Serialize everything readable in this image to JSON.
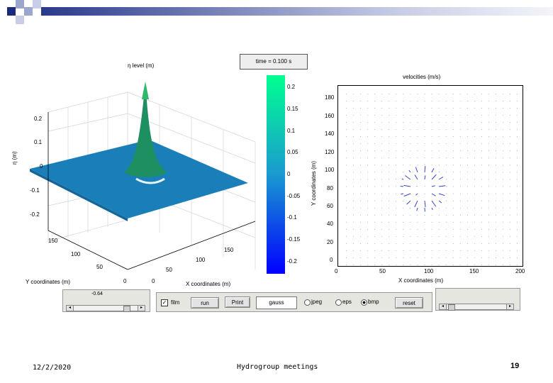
{
  "footer": {
    "date": "12/2/2020",
    "title": "Hydrogroup meetings",
    "page": "19"
  },
  "time_display": "time = 0.100 s",
  "left_plot": {
    "title": "η level (m)",
    "zlabel": "η (m)",
    "xlabel": "X coordinates (m)",
    "ylabel": "Y coordinates (m)",
    "z_ticks": [
      "0.2",
      "0.1",
      "0",
      "-0.1",
      "-0.2"
    ],
    "x_ticks": [
      "0",
      "50",
      "100",
      "150"
    ],
    "y_ticks": [
      "0",
      "50",
      "100",
      "150"
    ]
  },
  "colorbar": {
    "ticks": [
      "0.2",
      "0.15",
      "0.1",
      "0.05",
      "0",
      "-0.05",
      "-0.1",
      "-0.15",
      "-0.2"
    ],
    "min": -0.2,
    "max": 0.2
  },
  "right_plot": {
    "title": "velocities (m/s)",
    "xlabel": "X coordinates (m)",
    "ylabel": "Y coordinates (m)",
    "x_ticks": [
      "0",
      "50",
      "100",
      "150",
      "200"
    ],
    "y_ticks": [
      "0",
      "20",
      "40",
      "60",
      "80",
      "100",
      "120",
      "140",
      "160",
      "180"
    ]
  },
  "controls": {
    "left_slider_value": "-0.64",
    "film_label": "film",
    "film_checked": true,
    "run_label": "run",
    "print_label": "Print",
    "filename_value": "gauss",
    "format_options": [
      "jpeg",
      "eps",
      "bmp"
    ],
    "format_selected": "bmp",
    "reset_label": "reset"
  },
  "colors": {
    "surface": "#1a7fb8",
    "peak": "#1fa05a",
    "colorbar_top": "#00ff90",
    "colorbar_bottom": "#0000ff",
    "quiver": "#3344cc"
  }
}
